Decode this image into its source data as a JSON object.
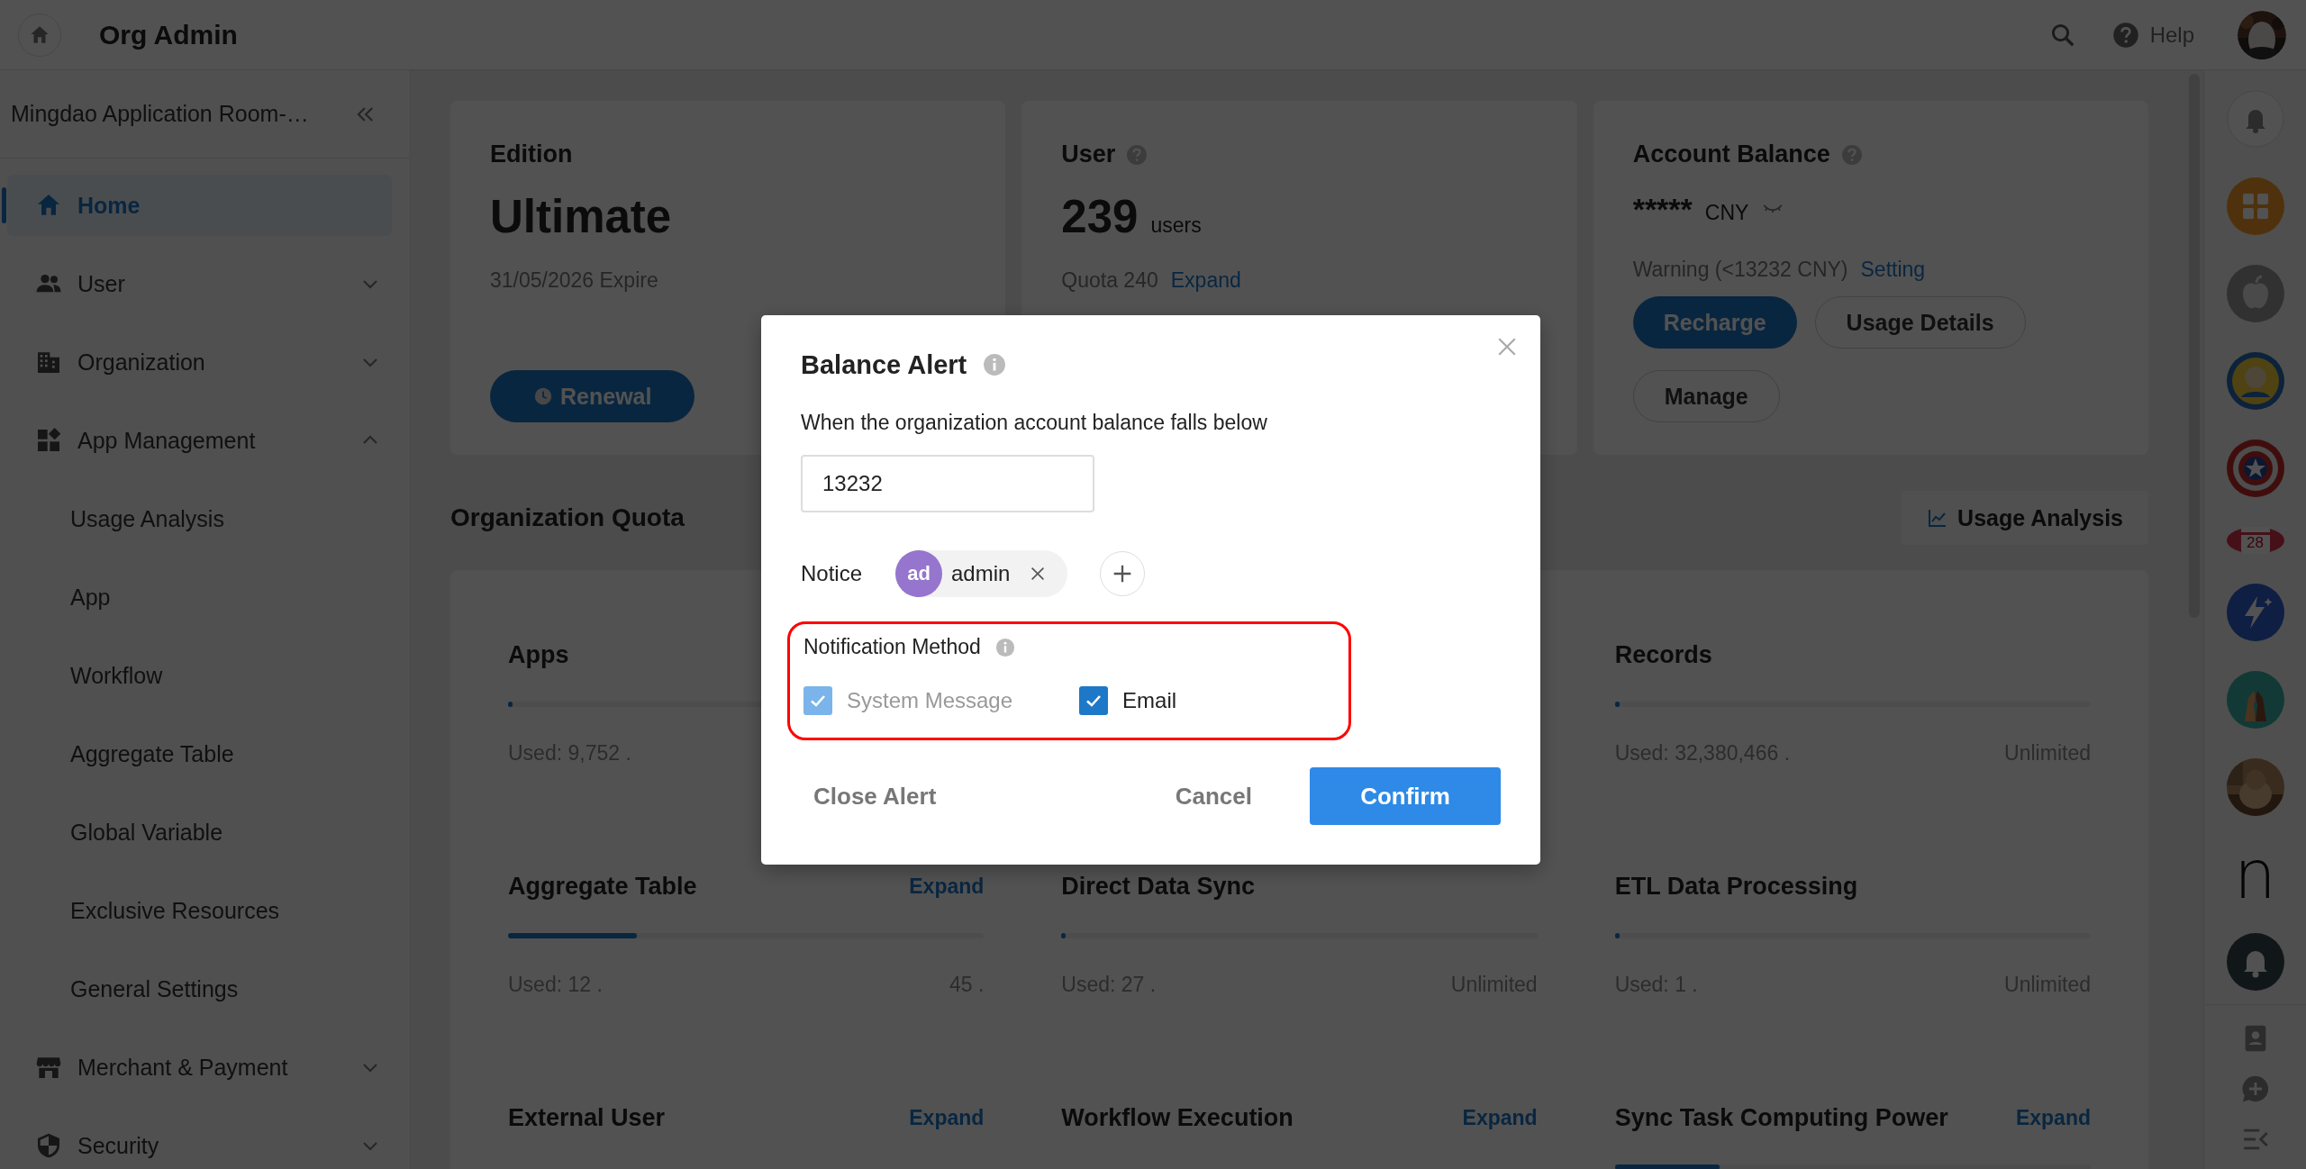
{
  "topbar": {
    "title": "Org Admin",
    "help": "Help"
  },
  "sidebar": {
    "org_name": "Mingdao Application Room-…",
    "items": [
      {
        "label": "Home",
        "selected": true
      },
      {
        "label": "User",
        "selected": false,
        "expanded": false
      },
      {
        "label": "Organization",
        "selected": false,
        "expanded": false
      },
      {
        "label": "App Management",
        "selected": false,
        "expanded": true,
        "children": [
          {
            "label": "Usage Analysis",
            "selected": false
          },
          {
            "label": "App",
            "selected": false
          },
          {
            "label": "Workflow",
            "selected": false
          },
          {
            "label": "Aggregate Table",
            "selected": false
          },
          {
            "label": "Global Variable",
            "selected": false
          },
          {
            "label": "Exclusive Resources",
            "selected": false
          },
          {
            "label": "General Settings",
            "selected": false
          }
        ]
      },
      {
        "label": "Merchant & Payment",
        "selected": false,
        "expanded": false
      },
      {
        "label": "Security",
        "selected": false,
        "expanded": false
      }
    ]
  },
  "cards": {
    "edition": {
      "title": "Edition",
      "value": "Ultimate",
      "expiry": "31/05/2026 Expire",
      "button": "Renewal"
    },
    "user": {
      "title": "User",
      "count": "239",
      "unit": "users",
      "quota": "Quota 240",
      "link": "Expand"
    },
    "balance": {
      "title": "Account Balance",
      "amount": "*****",
      "currency": "CNY",
      "warning": "Warning (<13232 CNY)",
      "link": "Setting",
      "buttons": [
        {
          "label": "Recharge",
          "kind": "primary"
        },
        {
          "label": "Usage Details",
          "kind": "outline"
        },
        {
          "label": "Manage",
          "kind": "outline"
        }
      ]
    }
  },
  "quota": {
    "title": "Organization Quota",
    "button": "Usage Analysis",
    "rows": [
      [
        {
          "title": "Apps",
          "level": 0.005,
          "used": "Used: 9,752 ."
        },
        null,
        {
          "title": "Records",
          "level": 0.005,
          "used": "Used: 32,380,466 .",
          "limit": "Unlimited"
        }
      ],
      [
        {
          "title": "Aggregate Table",
          "link": "Expand",
          "level": 0.27,
          "used": "Used: 12 .",
          "limit": "45 ."
        },
        {
          "title": "Direct Data Sync",
          "level": 0.008,
          "used": "Used: 27 .",
          "limit": "Unlimited"
        },
        {
          "title": "ETL Data Processing",
          "level": 0.008,
          "used": "Used: 1 .",
          "limit": "Unlimited"
        }
      ],
      [
        {
          "title": "External User",
          "link": "Expand"
        },
        {
          "title": "Workflow Execution",
          "link": "Expand"
        },
        {
          "title": "Sync Task Computing Power",
          "link": "Expand",
          "level": 0.22
        }
      ]
    ]
  },
  "dialog": {
    "title": "Balance Alert",
    "description": "When the organization account balance falls below",
    "threshold": "13232",
    "notice_label": "Notice",
    "recipients": [
      {
        "initials": "ad",
        "name": "admin"
      }
    ],
    "notification_method": {
      "label": "Notification Method",
      "highlighted": true,
      "options": [
        {
          "label": "System Message",
          "checked": true,
          "disabled": true
        },
        {
          "label": "Email",
          "checked": true,
          "disabled": false
        }
      ]
    },
    "buttons": [
      {
        "label": "Close Alert",
        "kind": "text"
      },
      {
        "label": "Cancel",
        "kind": "text"
      },
      {
        "label": "Confirm",
        "kind": "primary"
      }
    ]
  },
  "rail": {
    "calendar_date": "28",
    "app_letter": "n"
  }
}
